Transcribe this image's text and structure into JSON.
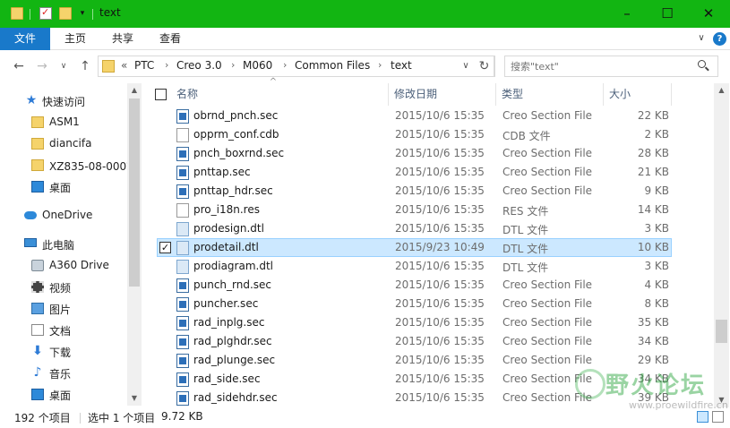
{
  "window": {
    "title": "text",
    "controls": {
      "minimize": "–",
      "maximize": "☐",
      "close": "✕"
    }
  },
  "ribbon": {
    "tabs": [
      {
        "label": "文件",
        "active": true
      },
      {
        "label": "主页",
        "active": false
      },
      {
        "label": "共享",
        "active": false
      },
      {
        "label": "查看",
        "active": false
      }
    ],
    "help": "?"
  },
  "address": {
    "overflow": "«",
    "crumbs": [
      "PTC",
      "Creo 3.0",
      "M060",
      "Common Files",
      "text"
    ],
    "search_placeholder": "搜索\"text\""
  },
  "nav": {
    "items": [
      {
        "label": "快速访问",
        "icon": "star-icon"
      },
      {
        "label": "ASM1",
        "icon": "folder-icon"
      },
      {
        "label": "diancifa",
        "icon": "folder-icon"
      },
      {
        "label": "XZ835-08-000前",
        "icon": "folder-icon"
      },
      {
        "label": "桌面",
        "icon": "desktop-icon"
      },
      {
        "label": "OneDrive",
        "icon": "cloud-icon"
      },
      {
        "label": "此电脑",
        "icon": "computer-icon"
      },
      {
        "label": "A360 Drive",
        "icon": "drive-icon"
      },
      {
        "label": "视频",
        "icon": "video-icon"
      },
      {
        "label": "图片",
        "icon": "picture-icon"
      },
      {
        "label": "文档",
        "icon": "document-icon"
      },
      {
        "label": "下载",
        "icon": "download-icon"
      },
      {
        "label": "音乐",
        "icon": "music-icon"
      },
      {
        "label": "桌面",
        "icon": "desktop-icon"
      }
    ]
  },
  "columns": {
    "name": "名称",
    "date": "修改日期",
    "type": "类型",
    "size": "大小"
  },
  "files": [
    {
      "name": "obrnd_pnch.sec",
      "date": "2015/10/6 15:35",
      "type": "Creo Section File",
      "size": "22 KB",
      "icon": "section-file-icon"
    },
    {
      "name": "opprm_conf.cdb",
      "date": "2015/10/6 15:35",
      "type": "CDB 文件",
      "size": "2 KB",
      "icon": "generic-file-icon"
    },
    {
      "name": "pnch_boxrnd.sec",
      "date": "2015/10/6 15:35",
      "type": "Creo Section File",
      "size": "28 KB",
      "icon": "section-file-icon"
    },
    {
      "name": "pnttap.sec",
      "date": "2015/10/6 15:35",
      "type": "Creo Section File",
      "size": "21 KB",
      "icon": "section-file-icon"
    },
    {
      "name": "pnttap_hdr.sec",
      "date": "2015/10/6 15:35",
      "type": "Creo Section File",
      "size": "9 KB",
      "icon": "section-file-icon"
    },
    {
      "name": "pro_i18n.res",
      "date": "2015/10/6 15:35",
      "type": "RES 文件",
      "size": "14 KB",
      "icon": "generic-file-icon"
    },
    {
      "name": "prodesign.dtl",
      "date": "2015/10/6 15:35",
      "type": "DTL 文件",
      "size": "3 KB",
      "icon": "dtl-file-icon"
    },
    {
      "name": "prodetail.dtl",
      "date": "2015/9/23 10:49",
      "type": "DTL 文件",
      "size": "10 KB",
      "icon": "dtl-file-icon",
      "selected": true
    },
    {
      "name": "prodiagram.dtl",
      "date": "2015/10/6 15:35",
      "type": "DTL 文件",
      "size": "3 KB",
      "icon": "dtl-file-icon"
    },
    {
      "name": "punch_rnd.sec",
      "date": "2015/10/6 15:35",
      "type": "Creo Section File",
      "size": "4 KB",
      "icon": "section-file-icon"
    },
    {
      "name": "puncher.sec",
      "date": "2015/10/6 15:35",
      "type": "Creo Section File",
      "size": "8 KB",
      "icon": "section-file-icon"
    },
    {
      "name": "rad_inplg.sec",
      "date": "2015/10/6 15:35",
      "type": "Creo Section File",
      "size": "35 KB",
      "icon": "section-file-icon"
    },
    {
      "name": "rad_plghdr.sec",
      "date": "2015/10/6 15:35",
      "type": "Creo Section File",
      "size": "34 KB",
      "icon": "section-file-icon"
    },
    {
      "name": "rad_plunge.sec",
      "date": "2015/10/6 15:35",
      "type": "Creo Section File",
      "size": "29 KB",
      "icon": "section-file-icon"
    },
    {
      "name": "rad_side.sec",
      "date": "2015/10/6 15:35",
      "type": "Creo Section File",
      "size": "34 KB",
      "icon": "section-file-icon"
    },
    {
      "name": "rad_sidehdr.sec",
      "date": "2015/10/6 15:35",
      "type": "Creo Section File",
      "size": "39 KB",
      "icon": "section-file-icon"
    }
  ],
  "status": {
    "count": "192 个项目",
    "selection": "选中 1 个项目",
    "size": "9.72 KB"
  },
  "watermark": {
    "text": "野火论坛",
    "url": "www.proewildfire.cn"
  },
  "colors": {
    "titlebar": "#12b512",
    "accent": "#1979ca",
    "selection": "#cce8ff"
  }
}
